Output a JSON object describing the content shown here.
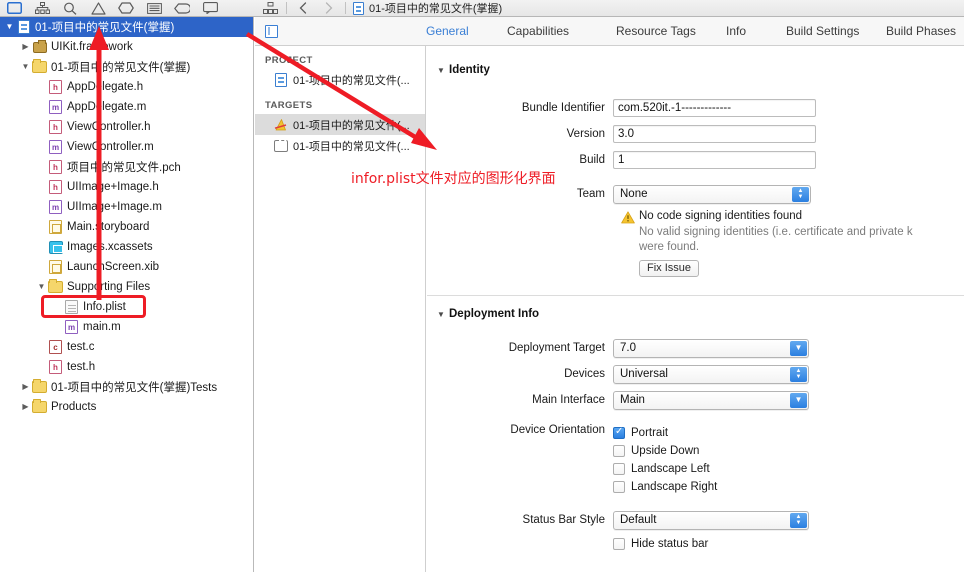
{
  "window": {
    "jump_bar_title": "01-项目中的常见文件(掌握)"
  },
  "navigator_toolbar": {
    "icons": [
      {
        "name": "project-navigator-icon",
        "glyph": "folder"
      },
      {
        "name": "symbol-navigator-icon",
        "glyph": "hierarchy"
      },
      {
        "name": "find-navigator-icon",
        "glyph": "search"
      },
      {
        "name": "issue-navigator-icon",
        "glyph": "warning"
      },
      {
        "name": "test-navigator-icon",
        "glyph": "diamond"
      },
      {
        "name": "debug-navigator-icon",
        "glyph": "lines"
      },
      {
        "name": "breakpoint-navigator-icon",
        "glyph": "tag"
      },
      {
        "name": "report-navigator-icon",
        "glyph": "speech"
      }
    ]
  },
  "navigator": {
    "rows": [
      {
        "label": "01-项目中的常见文件(掌握)",
        "icon": "project",
        "indent": 0,
        "twisty": "down",
        "selected": true
      },
      {
        "label": "UIKit.framework",
        "icon": "framework",
        "indent": 1,
        "twisty": "right",
        "selected": false
      },
      {
        "label": "01-项目中的常见文件(掌握)",
        "icon": "folder",
        "indent": 1,
        "twisty": "down",
        "selected": false
      },
      {
        "label": "AppDelegate.h",
        "icon": "h",
        "indent": 2,
        "twisty": "none",
        "selected": false
      },
      {
        "label": "AppDelegate.m",
        "icon": "m",
        "indent": 2,
        "twisty": "none",
        "selected": false
      },
      {
        "label": "ViewController.h",
        "icon": "h",
        "indent": 2,
        "twisty": "none",
        "selected": false
      },
      {
        "label": "ViewController.m",
        "icon": "m",
        "indent": 2,
        "twisty": "none",
        "selected": false
      },
      {
        "label": "项目中的常见文件.pch",
        "icon": "h",
        "indent": 2,
        "twisty": "none",
        "selected": false
      },
      {
        "label": "UIImage+Image.h",
        "icon": "h",
        "indent": 2,
        "twisty": "none",
        "selected": false
      },
      {
        "label": "UIImage+Image.m",
        "icon": "m",
        "indent": 2,
        "twisty": "none",
        "selected": false
      },
      {
        "label": "Main.storyboard",
        "icon": "xib",
        "indent": 2,
        "twisty": "none",
        "selected": false
      },
      {
        "label": "Images.xcassets",
        "icon": "assets",
        "indent": 2,
        "twisty": "none",
        "selected": false
      },
      {
        "label": "LaunchScreen.xib",
        "icon": "xib",
        "indent": 2,
        "twisty": "none",
        "selected": false
      },
      {
        "label": "Supporting Files",
        "icon": "folder",
        "indent": 2,
        "twisty": "down",
        "selected": false
      },
      {
        "label": "Info.plist",
        "icon": "plist",
        "indent": 3,
        "twisty": "none",
        "selected": false
      },
      {
        "label": "main.m",
        "icon": "m",
        "indent": 3,
        "twisty": "none",
        "selected": false
      },
      {
        "label": "test.c",
        "icon": "c",
        "indent": 2,
        "twisty": "none",
        "selected": false
      },
      {
        "label": "test.h",
        "icon": "h",
        "indent": 2,
        "twisty": "none",
        "selected": false
      },
      {
        "label": "01-项目中的常见文件(掌握)Tests",
        "icon": "folder",
        "indent": 1,
        "twisty": "right",
        "selected": false
      },
      {
        "label": "Products",
        "icon": "folder",
        "indent": 1,
        "twisty": "right",
        "selected": false
      }
    ]
  },
  "editor": {
    "tabs": [
      {
        "label": "General",
        "active": true
      },
      {
        "label": "Capabilities",
        "active": false
      },
      {
        "label": "Resource Tags",
        "active": false
      },
      {
        "label": "Info",
        "active": false
      },
      {
        "label": "Build Settings",
        "active": false
      },
      {
        "label": "Build Phases",
        "active": false
      }
    ]
  },
  "targets_pane": {
    "project_header": "PROJECT",
    "project_items": [
      {
        "label": "01-项目中的常见文件(...",
        "icon": "project",
        "selected": false
      }
    ],
    "targets_header": "TARGETS",
    "target_items": [
      {
        "label": "01-项目中的常见文件(...",
        "icon": "app-target",
        "selected": true
      },
      {
        "label": "01-项目中的常见文件(...",
        "icon": "test-target",
        "selected": false
      }
    ]
  },
  "identity": {
    "section_title": "Identity",
    "bundle_identifier_label": "Bundle Identifier",
    "bundle_identifier_value": "com.520it.-1-------------",
    "version_label": "Version",
    "version_value": "3.0",
    "build_label": "Build",
    "build_value": "1",
    "team_label": "Team",
    "team_value": "None",
    "warning_title": "No code signing identities found",
    "warning_desc_line1": "No valid signing identities (i.e. certificate and private k",
    "warning_desc_line2": "were found.",
    "fix_issue_label": "Fix Issue"
  },
  "deployment": {
    "section_title": "Deployment Info",
    "deployment_target_label": "Deployment Target",
    "deployment_target_value": "7.0",
    "devices_label": "Devices",
    "devices_value": "Universal",
    "main_interface_label": "Main Interface",
    "main_interface_value": "Main",
    "device_orientation_label": "Device Orientation",
    "orientations": [
      {
        "label": "Portrait",
        "checked": true
      },
      {
        "label": "Upside Down",
        "checked": false
      },
      {
        "label": "Landscape Left",
        "checked": false
      },
      {
        "label": "Landscape Right",
        "checked": false
      }
    ],
    "status_bar_style_label": "Status Bar Style",
    "status_bar_style_value": "Default",
    "hide_status_bar_label": "Hide status bar",
    "hide_status_bar_checked": false
  },
  "annotations": {
    "note_text": "infor.plist文件对应的图形化界面",
    "accent_color": "#ee1c25"
  }
}
